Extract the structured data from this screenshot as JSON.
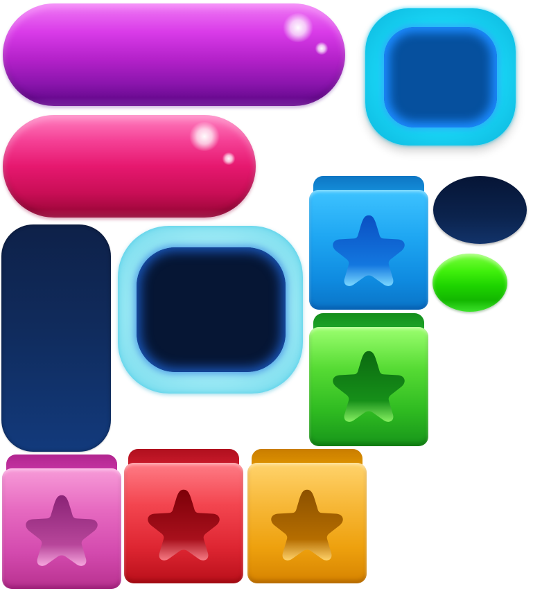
{
  "screen": {
    "title": "",
    "background": "#ffffff",
    "elements": [
      {
        "id": "pill-purple",
        "kind": "pill-button",
        "color": "#b321c9",
        "text": ""
      },
      {
        "id": "pill-pink",
        "kind": "pill-button",
        "color": "#e6186f",
        "text": ""
      },
      {
        "id": "glow-square-bright",
        "kind": "glowing-square-frame",
        "color": "#17d1f2",
        "inner_color": "#06509e"
      },
      {
        "id": "glow-square-dark",
        "kind": "glowing-square-frame",
        "color": "#9deaf5",
        "inner_color": "#061634"
      },
      {
        "id": "navy-tall",
        "kind": "rounded-panel",
        "color": "#102b5c"
      },
      {
        "id": "oval-navy",
        "kind": "oval-button",
        "color": "#0b234d"
      },
      {
        "id": "oval-green",
        "kind": "oval-button",
        "color": "#1ed400"
      },
      {
        "id": "box-blue",
        "kind": "star-box",
        "color": "#1ea6f2",
        "icon": "star-icon"
      },
      {
        "id": "box-green",
        "kind": "star-box",
        "color": "#2fbb21",
        "icon": "star-icon"
      },
      {
        "id": "box-pink",
        "kind": "star-box",
        "color": "#e669c0",
        "icon": "star-icon"
      },
      {
        "id": "box-red",
        "kind": "star-box",
        "color": "#f3454f",
        "icon": "star-icon"
      },
      {
        "id": "box-orange",
        "kind": "star-box",
        "color": "#f7b838",
        "icon": "star-icon"
      }
    ]
  }
}
